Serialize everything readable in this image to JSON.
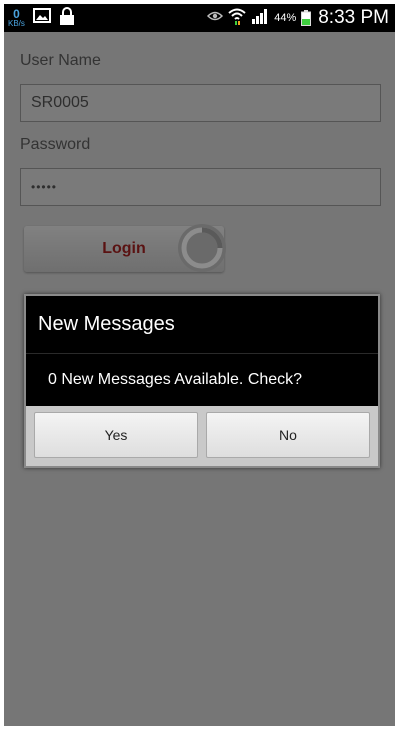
{
  "status_bar": {
    "net_speed_value": "0",
    "net_speed_unit": "KB/s",
    "battery_percent": "44%",
    "time": "8:33 PM",
    "icons": [
      "image-icon",
      "lock-icon",
      "eye-icon",
      "wifi-icon",
      "signal-icon",
      "battery-icon"
    ]
  },
  "form": {
    "username_label": "User Name",
    "username_value": "SR0005",
    "password_label": "Password",
    "password_value": "•••••",
    "login_label": "Login"
  },
  "dialog": {
    "title": "New Messages",
    "message": "0 New Messages Available. Check?",
    "yes_label": "Yes",
    "no_label": "No"
  },
  "colors": {
    "dim_background": "#767676",
    "login_text": "#5a1212",
    "net_speed_accent": "#4aa3df",
    "battery_level": "#3ecf3e"
  }
}
